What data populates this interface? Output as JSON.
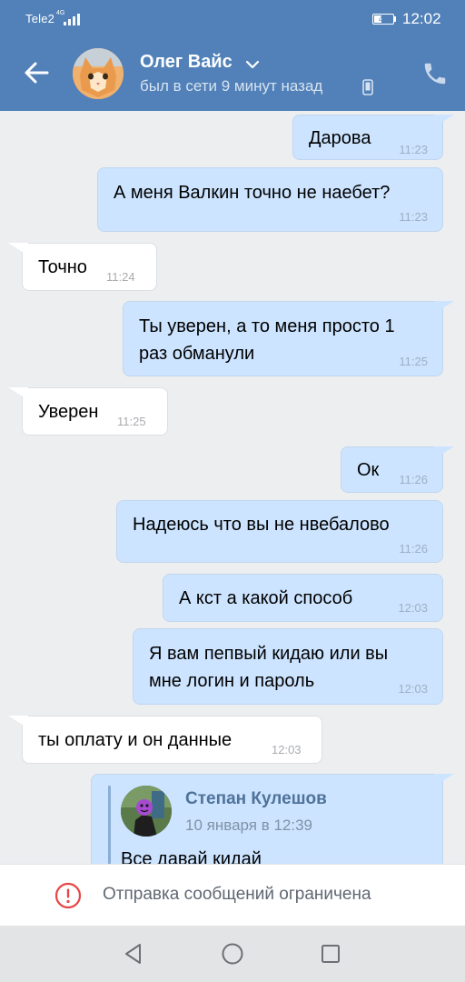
{
  "status_bar": {
    "carrier": "Tele2",
    "network": "4G",
    "battery": "42",
    "time": "12:02"
  },
  "header": {
    "contact_name": "Олег Вайс",
    "last_seen": "был в сети 9 минут назад",
    "icons": [
      "back-arrow-icon",
      "chevron-down-icon",
      "mobile-device-icon",
      "phone-call-icon"
    ]
  },
  "messages": [
    {
      "direction": "out",
      "text": "Дарова",
      "time": "11:23"
    },
    {
      "direction": "out",
      "text": "А меня Валкин точно не наебет?",
      "time": "11:23"
    },
    {
      "direction": "in",
      "text": "Точно",
      "time": "11:24"
    },
    {
      "direction": "out",
      "text": "Ты уверен, а то меня просто 1 раз обманули",
      "lines": [
        "Ты уверен, а то меня просто 1",
        "раз обманули"
      ],
      "time": "11:25"
    },
    {
      "direction": "in",
      "text": "Уверен",
      "time": "11:25"
    },
    {
      "direction": "out",
      "text": "Ок",
      "time": "11:26"
    },
    {
      "direction": "out",
      "text": "Надеюсь что вы не нвебалово",
      "time": "11:26"
    },
    {
      "direction": "out",
      "text": "А кст а какой способ",
      "time": "12:03"
    },
    {
      "direction": "out",
      "text": "Я вам пепвый кидаю или вы мне логин и пароль",
      "lines": [
        "Я вам пепвый кидаю или вы",
        "мне логин и пароль"
      ],
      "time": "12:03"
    },
    {
      "direction": "in",
      "text": "ты оплату и он данные",
      "time": "12:03"
    }
  ],
  "forwarded": {
    "author": "Степан Кулешов",
    "date": "10 января в 12:39",
    "text": "Все давай кидай"
  },
  "restriction": {
    "text": "Отправка сообщений ограничена",
    "icon": "warning-circle-icon"
  },
  "navbar": {
    "icons": [
      "nav-back-icon",
      "nav-home-icon",
      "nav-recents-icon"
    ]
  },
  "colors": {
    "header": "#5181b8",
    "outgoing_bubble": "#cce4ff",
    "incoming_bubble": "#ffffff",
    "background": "#edeef0",
    "warning": "#e64646"
  }
}
